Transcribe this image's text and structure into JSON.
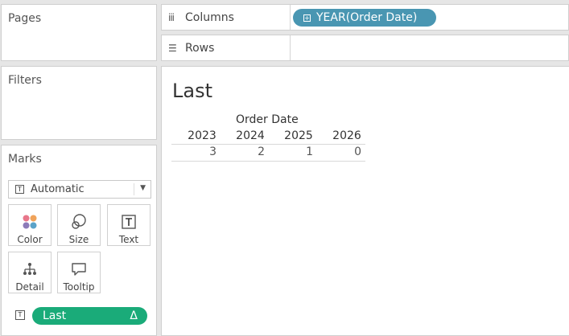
{
  "panels": {
    "pages_title": "Pages",
    "filters_title": "Filters",
    "marks_title": "Marks"
  },
  "shelves": {
    "columns_label": "Columns",
    "rows_label": "Rows",
    "columns_pill": "YEAR(Order Date)"
  },
  "marks": {
    "mark_type": "Automatic",
    "buttons": {
      "color": "Color",
      "size": "Size",
      "text": "Text",
      "detail": "Detail",
      "tooltip": "Tooltip"
    },
    "text_pill": "Last",
    "text_pill_delta": "Δ"
  },
  "view": {
    "sheet_title": "Last",
    "header_title": "Order Date",
    "columns": [
      {
        "year": "2023",
        "value": "3"
      },
      {
        "year": "2024",
        "value": "2"
      },
      {
        "year": "2025",
        "value": "1"
      },
      {
        "year": "2026",
        "value": "0"
      }
    ]
  },
  "colors": {
    "dimension_pill": "#4996b2",
    "measure_pill": "#1aab79"
  }
}
